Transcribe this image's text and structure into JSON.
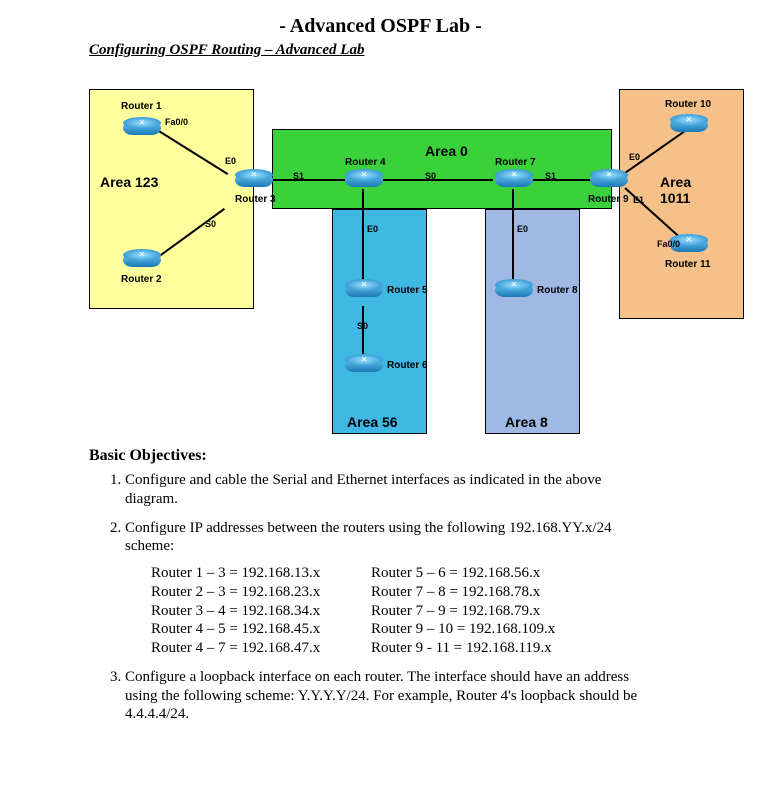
{
  "title": "- Advanced OSPF Lab -",
  "subtitle": "Configuring OSPF Routing – Advanced Lab",
  "areas": {
    "a123": "Area 123",
    "a0": "Area 0",
    "a56": "Area 56",
    "a8": "Area 8",
    "a1011": "Area 1011"
  },
  "routers": {
    "r1": "Router 1",
    "r2": "Router 2",
    "r3": "Router 3",
    "r4": "Router 4",
    "r5": "Router 5",
    "r6": "Router 6",
    "r7": "Router 7",
    "r8": "Router 8",
    "r9": "Router 9",
    "r10": "Router 10",
    "r11": "Router 11"
  },
  "if": {
    "fa00_a": "Fa0/0",
    "e0_a": "E0",
    "s0_a": "S0",
    "s1_a": "S1",
    "s0_b": "S0",
    "s1_b": "S1",
    "e0_b": "E0",
    "e0_c": "E0",
    "s0_c": "S0",
    "e0_d": "E0",
    "e1": "E1",
    "fa00_b": "Fa0/0"
  },
  "objectivesHead": "Basic Objectives:",
  "obj": {
    "o1": "Configure and cable the Serial and Ethernet interfaces as indicated in the above diagram.",
    "o2a": "Configure IP addresses between the routers using the following 192.168.YY.x/24 scheme:",
    "o3": "Configure a loopback interface on each router. The interface should have an address using the following scheme: Y.Y.Y.Y/24. For example, Router 4's loopback should be 4.4.4.4/24."
  },
  "ip": {
    "l1": "Router 1 – 3 = 192.168.13.x",
    "l2": "Router 2 – 3 = 192.168.23.x",
    "l3": "Router 3 – 4 = 192.168.34.x",
    "l4": "Router 4 – 5 = 192.168.45.x",
    "l5": "Router 4 – 7 = 192.168.47.x",
    "r1": "Router 5 – 6 = 192.168.56.x",
    "r2": "Router 7 – 8 = 192.168.78.x",
    "r3": "Router 7 – 9 = 192.168.79.x",
    "r4": "Router 9 – 10 = 192.168.109.x",
    "r5": "Router 9 - 11 = 192.168.119.x"
  }
}
